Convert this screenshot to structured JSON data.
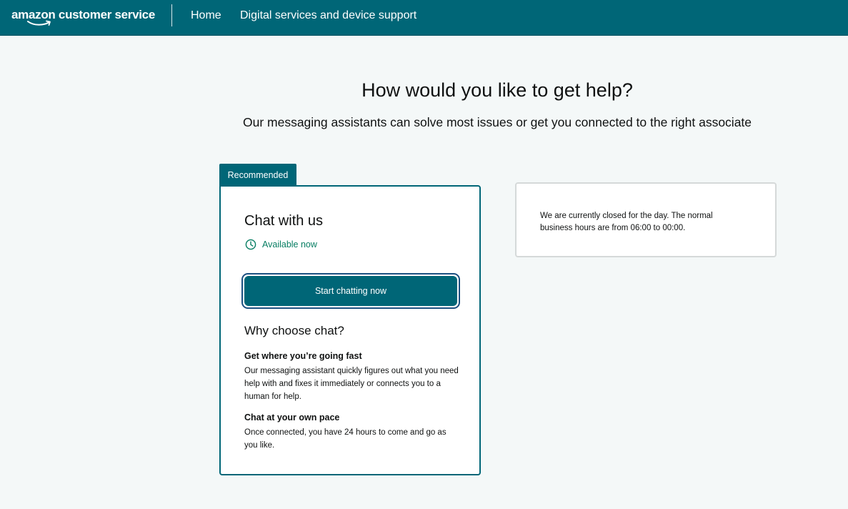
{
  "header": {
    "logo_text": "amazon customer service",
    "nav": {
      "home": "Home",
      "digital": "Digital services and device support"
    },
    "colors": {
      "background": "#006677",
      "text": "#ffffff"
    }
  },
  "main": {
    "title": "How would you like to get help?",
    "subtitle": "Our messaging assistants can solve most issues or get you connected to the right associate"
  },
  "chat_card": {
    "badge": "Recommended",
    "title": "Chat with us",
    "availability": "Available now",
    "availability_icon": "clock-icon",
    "button_label": "Start chatting now",
    "why_title": "Why choose chat?",
    "benefits": [
      {
        "title": "Get where you’re going fast",
        "text": "Our messaging assistant quickly figures out what you need help with and fixes it immediately or connects you to a human for help."
      },
      {
        "title": "Chat at your own pace",
        "text": "Once connected, you have 24 hours to come and go as you like."
      }
    ],
    "colors": {
      "accent": "#006677",
      "available": "#067d62",
      "focus_ring": "#1b4f80"
    }
  },
  "closed_card": {
    "text": "We are currently closed for the day. The normal business hours are from 06:00 to 00:00."
  }
}
